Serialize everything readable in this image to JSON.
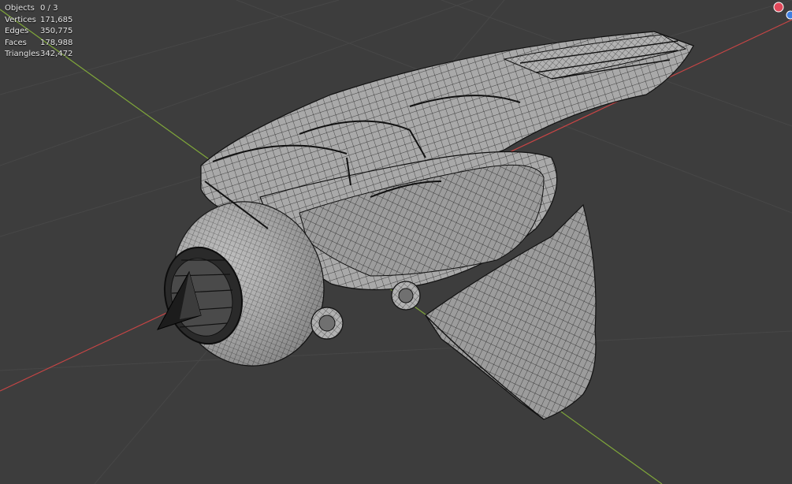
{
  "overlay": {
    "stats": [
      {
        "label": "Objects",
        "value": "0 / 3"
      },
      {
        "label": "Vertices",
        "value": "171,685"
      },
      {
        "label": "Edges",
        "value": "350,775"
      },
      {
        "label": "Faces",
        "value": "178,988"
      },
      {
        "label": "Triangles",
        "value": "342,472"
      }
    ]
  },
  "viewport": {
    "background": "#3d3d3d",
    "mesh_fill": "#a7a7a7",
    "wire_color": "#1a1a1a",
    "x_axis_color": "#c74545",
    "y_axis_color": "#7fa63a"
  },
  "gizmo": {
    "x_color": "#e0485a",
    "y_color": "#3f7fe0"
  }
}
